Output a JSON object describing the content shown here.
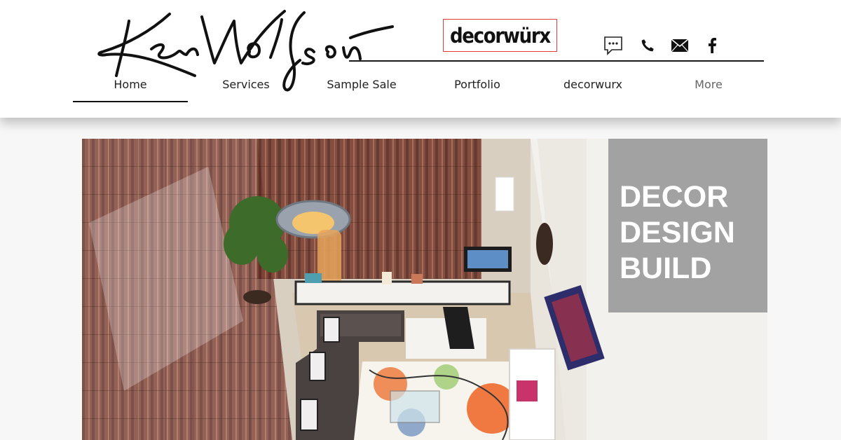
{
  "header": {
    "logo_text": "Ken Wolfson",
    "brand_badge": "decorwürx",
    "icons": [
      "chat-icon",
      "phone-icon",
      "email-icon",
      "facebook-icon"
    ]
  },
  "nav": {
    "items": [
      {
        "label": "Home",
        "active": true
      },
      {
        "label": "Services"
      },
      {
        "label": "Sample Sale"
      },
      {
        "label": "Portfolio"
      },
      {
        "label": "decorwurx"
      },
      {
        "label": "More"
      }
    ]
  },
  "hero": {
    "overlay_lines": [
      "DECOR",
      "DESIGN",
      "BUILD"
    ],
    "overlay_color": "#969698"
  },
  "colors": {
    "badge_border": "#e33b3b",
    "page_bg": "#f7f7f7",
    "text": "#222222"
  }
}
